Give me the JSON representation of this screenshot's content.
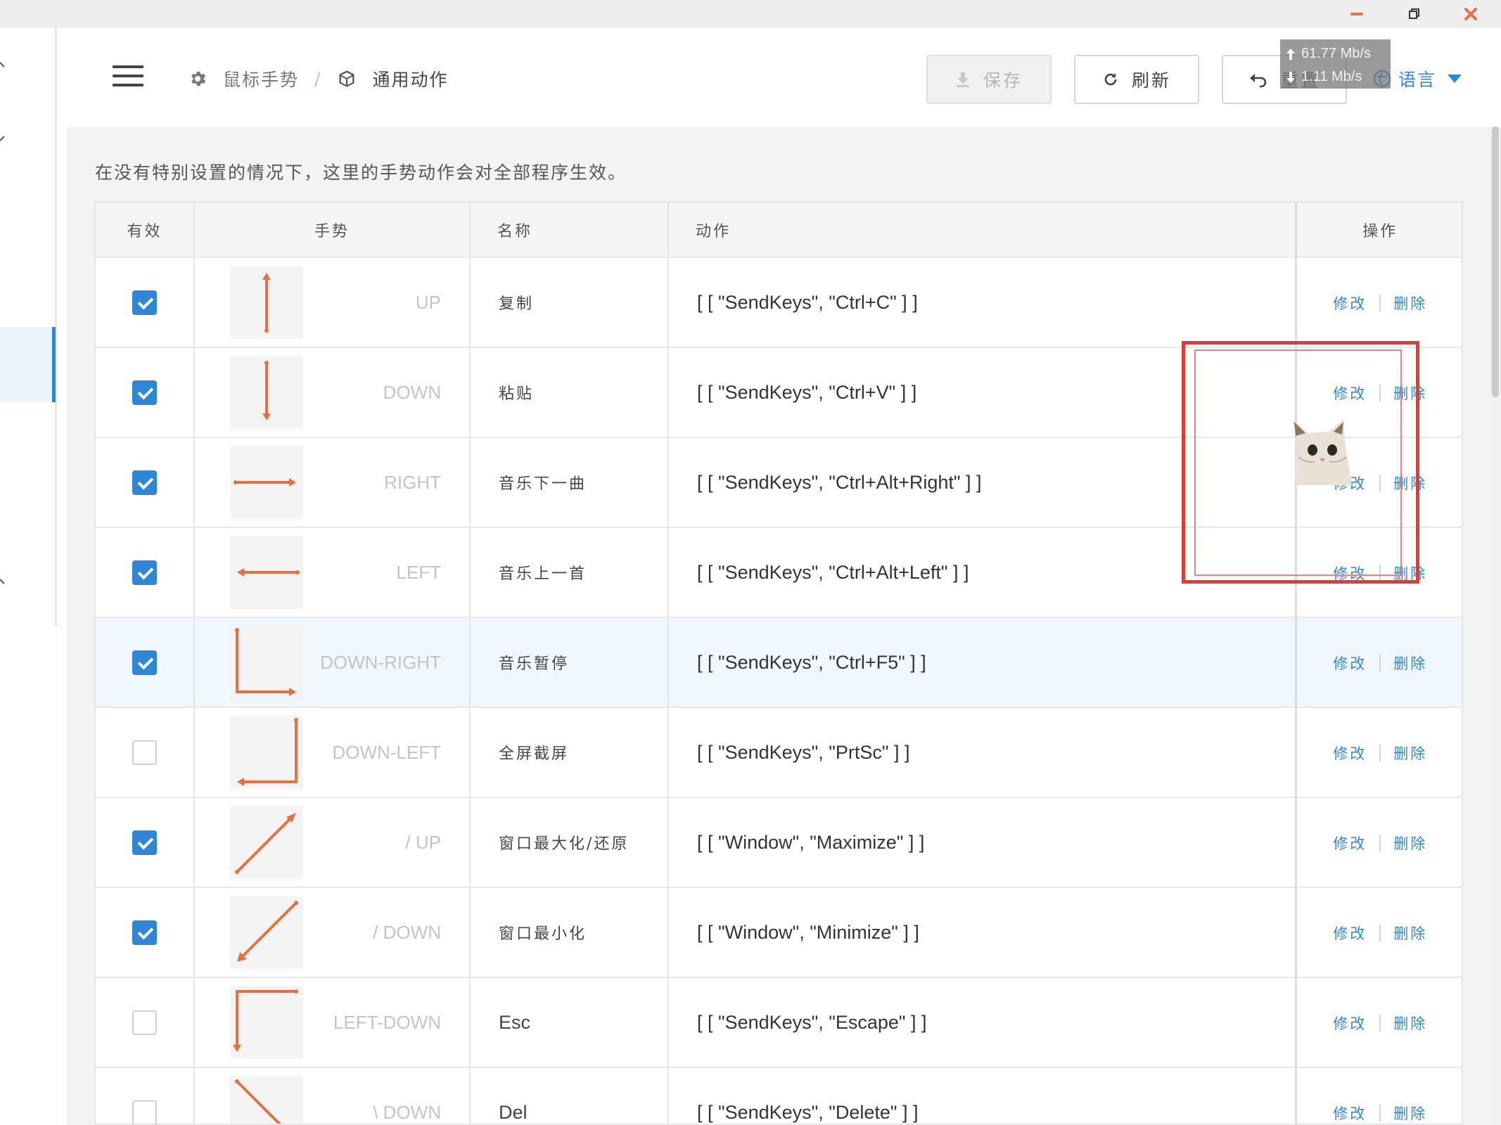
{
  "window": {
    "controls": [
      "minimize",
      "maximize",
      "close"
    ]
  },
  "header": {
    "breadcrumb": {
      "parent": "鼠标手势",
      "separator": "/",
      "current": "通用动作"
    },
    "buttons": {
      "save": "保存",
      "refresh": "刷新",
      "reset": "重置"
    },
    "language": "语言"
  },
  "netmon": {
    "up": "61.77 Mb/s",
    "down": "1.11 Mb/s"
  },
  "main": {
    "description": "在没有特别设置的情况下，这里的手势动作会对全部程序生效。",
    "columns": {
      "valid": "有效",
      "gesture": "手势",
      "name": "名称",
      "action": "动作",
      "ops": "操作"
    },
    "op_labels": {
      "edit": "修改",
      "delete": "删除"
    },
    "rows": [
      {
        "valid": true,
        "gesture": "UP",
        "icon": "arrow-up-icon",
        "name": "复制",
        "action": "[ [ \"SendKeys\", \"Ctrl+C\" ] ]"
      },
      {
        "valid": true,
        "gesture": "DOWN",
        "icon": "arrow-down-icon",
        "name": "粘贴",
        "action": "[ [ \"SendKeys\", \"Ctrl+V\" ] ]"
      },
      {
        "valid": true,
        "gesture": "RIGHT",
        "icon": "arrow-right-icon",
        "name": "音乐下一曲",
        "action": "[ [ \"SendKeys\", \"Ctrl+Alt+Right\" ] ]"
      },
      {
        "valid": true,
        "gesture": "LEFT",
        "icon": "arrow-left-icon",
        "name": "音乐上一首",
        "action": "[ [ \"SendKeys\", \"Ctrl+Alt+Left\" ] ]"
      },
      {
        "valid": true,
        "gesture": "DOWN-RIGHT",
        "icon": "arrow-down-right-icon",
        "name": "音乐暂停",
        "action": "[ [ \"SendKeys\", \"Ctrl+F5\" ] ]"
      },
      {
        "valid": false,
        "gesture": "DOWN-LEFT",
        "icon": "arrow-down-left-icon",
        "name": "全屏截屏",
        "action": "[ [ \"SendKeys\", \"PrtSc\" ] ]"
      },
      {
        "valid": true,
        "gesture": "/ UP",
        "icon": "arrow-diag-up-icon",
        "name": "窗口最大化/还原",
        "action": "[ [ \"Window\", \"Maximize\" ] ]"
      },
      {
        "valid": true,
        "gesture": "/ DOWN",
        "icon": "arrow-diag-down-icon",
        "name": "窗口最小化",
        "action": "[ [ \"Window\", \"Minimize\" ] ]"
      },
      {
        "valid": false,
        "gesture": "LEFT-DOWN",
        "icon": "arrow-left-down-icon",
        "name": "Esc",
        "action": "[ [ \"SendKeys\", \"Escape\" ] ]"
      },
      {
        "valid": false,
        "gesture": "\\ DOWN",
        "icon": "arrow-backslash-down-icon",
        "name": "Del",
        "action": "[ [ \"SendKeys\", \"Delete\" ] ]"
      }
    ]
  },
  "colors": {
    "accent": "#2f86d8",
    "gesture_stroke": "#e8703f",
    "highlight_row": "#f0f8fd",
    "overlay_rect": "#e53935"
  },
  "highlighted_row_index": 4
}
